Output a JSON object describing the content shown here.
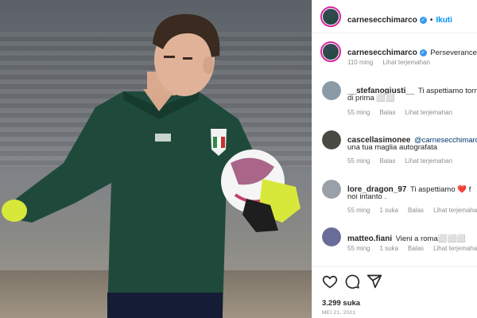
{
  "post": {
    "username": "carnesecchimarco",
    "follow_label": "Ikuti",
    "separator": "•",
    "caption": "Perseverance.",
    "caption_time": "110 ming",
    "see_translation": "Lihat terjemahan"
  },
  "comments": [
    {
      "username": "__stefanogiusti__",
      "text_line1": "Ti aspettiamo torn",
      "text_line2": "di prima ⬜⬜",
      "time": "55 ming",
      "reply": "Balas",
      "translate": "Lihat terjemahan",
      "avatar_color": "#8a9aa6"
    },
    {
      "username": "cascellasimonee",
      "mention": "@carnesecchimarco",
      "text_line2": "una tua maglia autografata",
      "time": "55 ming",
      "reply": "Balas",
      "translate": "Lihat terjemahan",
      "avatar_color": "#4a4a44"
    },
    {
      "username": "lore_dragon_97",
      "text_line1": "Ti aspettiamo ❤️ f",
      "text_line2": "noi intanto .",
      "time": "55 ming",
      "likes": "1 suka",
      "reply": "Balas",
      "translate": "Lihat terjemahan",
      "avatar_color": "#9aa0a8"
    },
    {
      "username": "matteo.fiani",
      "text_line1": "Vieni a roma⬜⬜⬜",
      "time": "55 ming",
      "likes": "1 suka",
      "reply": "Balas",
      "translate": "Lihat terjemahan",
      "avatar_color": "#6a6c9a"
    }
  ],
  "actions": {
    "like_icon": "heart-icon",
    "comment_icon": "comment-icon",
    "share_icon": "share-icon",
    "likes_count": "3.299 suka",
    "date": "MEI 21, 2021"
  },
  "colors": {
    "accent_blue": "#0095f6",
    "verified_blue": "#3897f0",
    "jersey_green": "#1f4a3b",
    "glove_yellow": "#d8e83a"
  }
}
